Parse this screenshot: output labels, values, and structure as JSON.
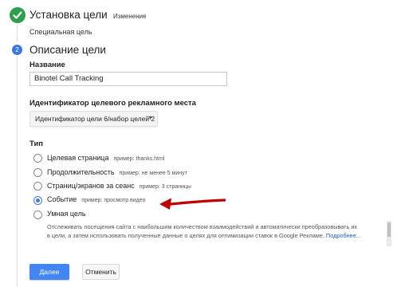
{
  "step1": {
    "title": "Установка цели",
    "edit_label": "Изменение",
    "subtitle": "Специальная цель"
  },
  "step2": {
    "number": "2",
    "title": "Описание цели",
    "name_label": "Название",
    "name_value": "Binotel Call Tracking",
    "id_label": "Идентификатор целевого рекламного места",
    "id_value": "Идентификатор цели 6/набор целей 2",
    "type_label": "Тип",
    "options": [
      {
        "label": "Целевая страница",
        "example": "пример: thanks.html",
        "selected": false
      },
      {
        "label": "Продолжительность",
        "example": "пример: не менее 5 минут",
        "selected": false
      },
      {
        "label": "Страниц/экранов за сеанс",
        "example": "пример: 3 страницы",
        "selected": false
      },
      {
        "label": "Событие",
        "example": "пример: просмотр видео",
        "selected": true
      },
      {
        "label": "Умная цель",
        "example": "",
        "selected": false
      }
    ],
    "smart_desc_line1": "Отслеживать посещения сайта с наибольшим количеством взаимодействий и автоматически преобразовывать их",
    "smart_desc_line2": "в цели, а затем использовать полученные данные о целях для оптимизации ставок в Google Рекламе.",
    "smart_desc_more": "Подробнее..."
  },
  "buttons": {
    "next": "Далее",
    "cancel": "Отменить"
  },
  "colors": {
    "check": "#2e9e4f",
    "accent": "#3b78e7",
    "primary_button": "#4285f4",
    "arrow": "#c00000"
  },
  "icons": {
    "step1": "checkmark-icon",
    "dropdown": "caret-down-icon",
    "annotation": "red-arrow"
  }
}
